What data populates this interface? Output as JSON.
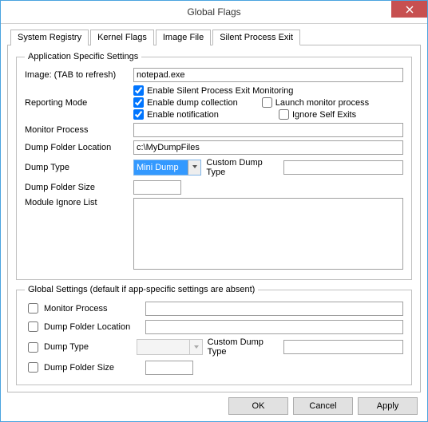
{
  "window_title": "Global Flags",
  "tabs": [
    "System Registry",
    "Kernel Flags",
    "Image File",
    "Silent Process Exit"
  ],
  "app_group": {
    "legend": "Application Specific Settings",
    "image_label": "Image:  (TAB to refresh)",
    "image_value": "notepad.exe",
    "reporting_mode_label": "Reporting Mode",
    "chk_enable_monitoring": "Enable Silent Process Exit Monitoring",
    "chk_enable_dump": "Enable dump collection",
    "chk_launch_monitor": "Launch monitor process",
    "chk_enable_notif": "Enable notification",
    "chk_ignore_self": "Ignore Self Exits",
    "monitor_process_label": "Monitor Process",
    "monitor_process_value": "",
    "dump_folder_label": "Dump Folder Location",
    "dump_folder_value": "c:\\MyDumpFiles",
    "dump_type_label": "Dump Type",
    "dump_type_value": "Mini Dump",
    "custom_dump_label": "Custom Dump Type",
    "custom_dump_value": "",
    "dump_folder_size_label": "Dump Folder Size",
    "dump_folder_size_value": "",
    "module_ignore_label": "Module Ignore List",
    "module_ignore_value": ""
  },
  "global_group": {
    "legend": "Global Settings (default if app-specific settings are absent)",
    "monitor_process_label": "Monitor Process",
    "monitor_process_value": "",
    "dump_folder_label": "Dump Folder Location",
    "dump_folder_value": "",
    "dump_type_label": "Dump Type",
    "dump_type_value": "",
    "custom_dump_label": "Custom Dump Type",
    "custom_dump_value": "",
    "dump_folder_size_label": "Dump Folder Size",
    "dump_folder_size_value": ""
  },
  "buttons": {
    "ok": "OK",
    "cancel": "Cancel",
    "apply": "Apply"
  }
}
